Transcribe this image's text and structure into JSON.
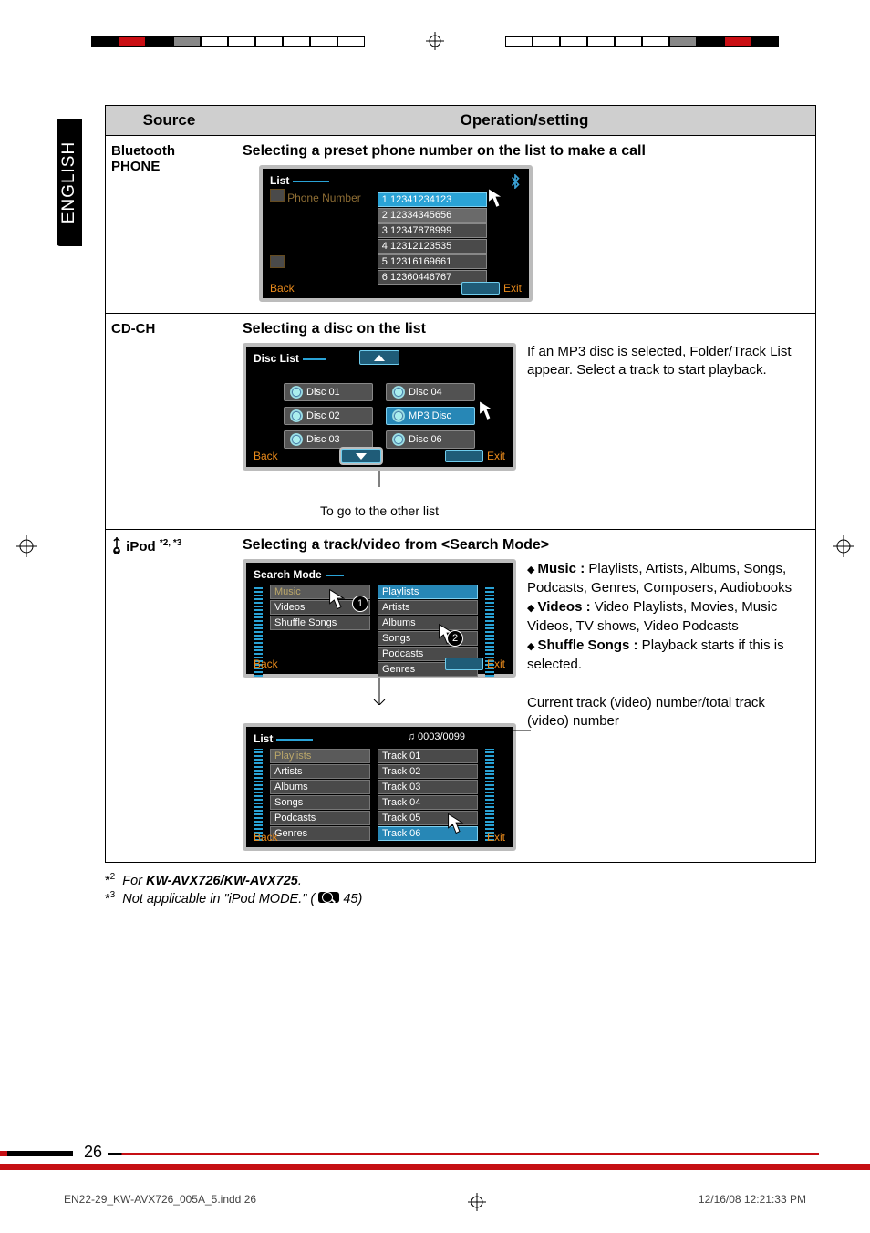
{
  "lang_tab": "ENGLISH",
  "table": {
    "header_source": "Source",
    "header_op": "Operation/setting"
  },
  "row_bt": {
    "source": "Bluetooth PHONE",
    "subtitle": "Selecting a preset phone number on the list to make a call",
    "scr_title": "List",
    "phone_number_label": "Phone Number",
    "numbers": [
      "1  12341234123",
      "2  12334345656",
      "3  12347878999",
      "4  12312123535",
      "5  12316169661",
      "6  12360446767"
    ],
    "back": "Back",
    "exit": "Exit"
  },
  "row_cd": {
    "source": "CD-CH",
    "subtitle": "Selecting a disc on the list",
    "scr_title": "Disc List",
    "discs_left": [
      "Disc 01",
      "Disc 02",
      "Disc 03"
    ],
    "discs_right": [
      "Disc 04",
      "MP3 Disc",
      "Disc 06"
    ],
    "back": "Back",
    "exit": "Exit",
    "caption": "To go to the other list",
    "note": "If an MP3 disc is selected, Folder/Track List appear. Select a track to start playback."
  },
  "row_ipod": {
    "source_prefix": "iPod ",
    "source_sup": "*2, *3",
    "subtitle": "Selecting a track/video from <Search Mode>",
    "scr_title": "Search Mode",
    "left_items": [
      "Music",
      "Videos",
      "Shuffle Songs"
    ],
    "right_items": [
      "Playlists",
      "Artists",
      "Albums",
      "Songs",
      "Podcasts",
      "Genres"
    ],
    "back": "Back",
    "exit": "Exit",
    "bullets": [
      {
        "t": "Music :",
        "d": " Playlists, Artists, Albums, Songs, Podcasts, Genres, Composers, Audiobooks"
      },
      {
        "t": "Videos :",
        "d": " Video Playlists, Movies, Music Videos, TV shows, Video Podcasts"
      },
      {
        "t": "Shuffle Songs :",
        "d": " Playback starts if this is selected."
      }
    ],
    "scr2_title": "List",
    "track_counter": "0003/0099",
    "scr2_left": [
      "Playlists",
      "Artists",
      "Albums",
      "Songs",
      "Podcasts",
      "Genres"
    ],
    "scr2_right": [
      "Track 01",
      "Track 02",
      "Track 03",
      "Track 04",
      "Track 05",
      "Track 06"
    ],
    "counter_desc": "Current track (video) number/total track (video) number"
  },
  "footnotes": {
    "f2_pre": "For ",
    "f2_b": "KW-AVX726/KW-AVX725",
    "f2_post": ".",
    "f3_pre": "Not applicable in \"iPod MODE.\" (",
    "f3_page": "45",
    "f3_post": ")"
  },
  "page_number": "26",
  "print_footer_left": "EN22-29_KW-AVX726_005A_5.indd   26",
  "print_footer_right": "12/16/08   12:21:33 PM"
}
